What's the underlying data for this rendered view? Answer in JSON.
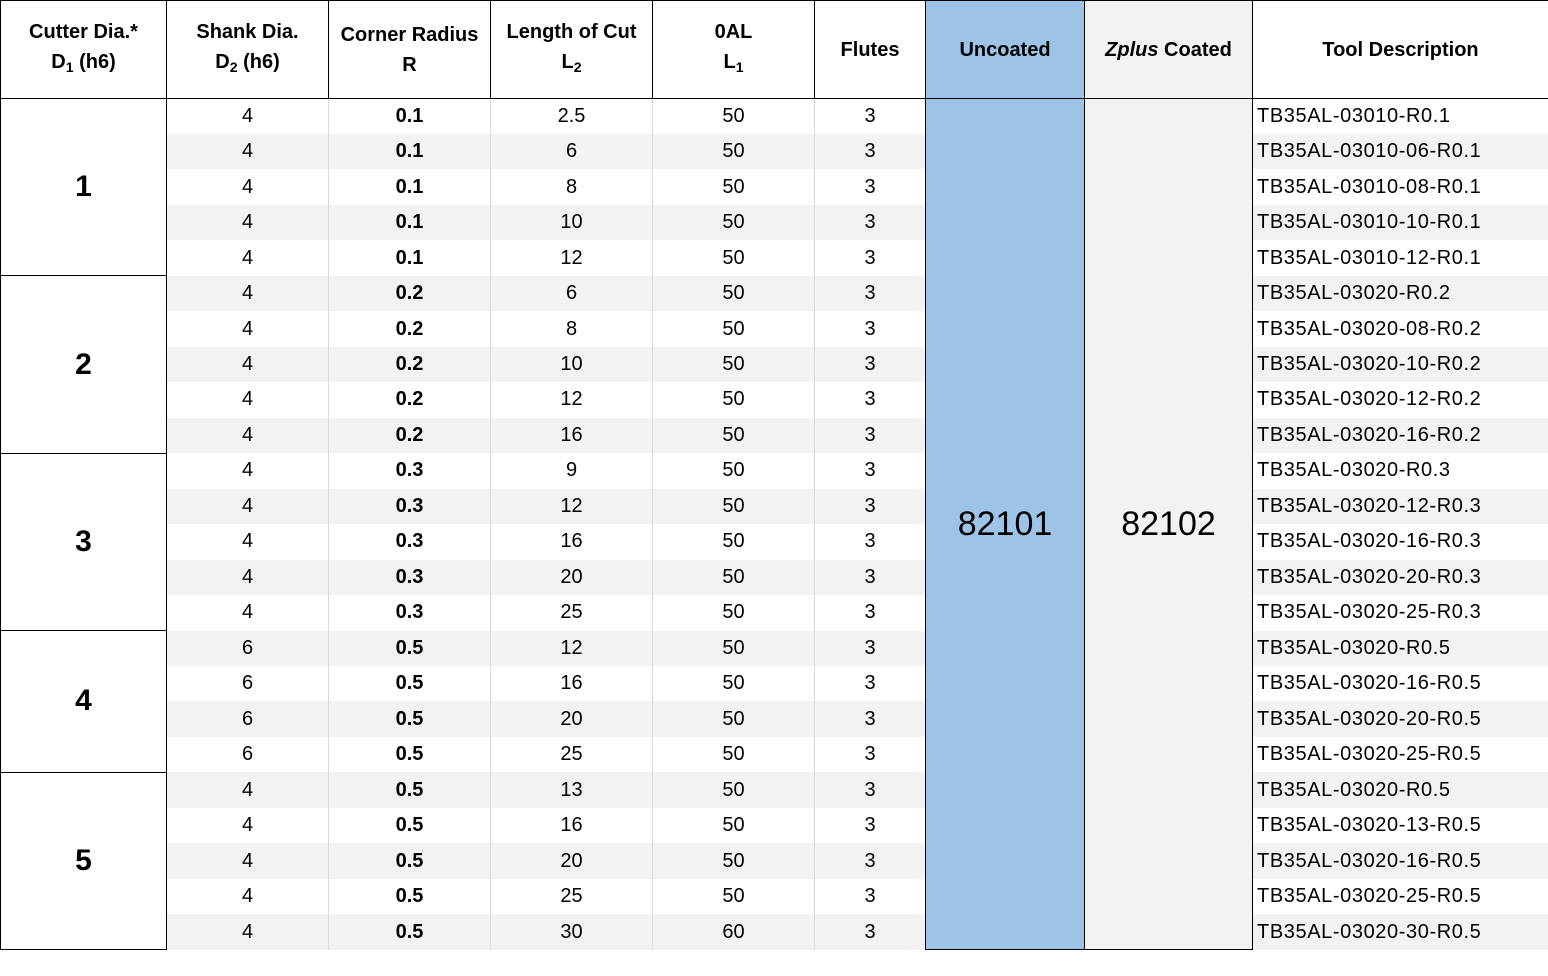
{
  "headers": {
    "cutter_dia": {
      "line1": "Cutter Dia.*",
      "main": "D",
      "sub": "1",
      "rest": " (h6)"
    },
    "shank_dia": {
      "line1": "Shank Dia.",
      "main": "D",
      "sub": "2",
      "rest": " (h6)"
    },
    "corner_radius": {
      "line1": "Corner Radius",
      "line2": "R"
    },
    "length_of_cut": {
      "line1": "Length of Cut",
      "main": "L",
      "sub": "2"
    },
    "oal": {
      "line1": "0AL",
      "main": "L",
      "sub": "1"
    },
    "flutes": "Flutes",
    "uncoated": "Uncoated",
    "zplus_italic": "Zplus",
    "zplus_rest": " Coated",
    "tool_description": "Tool Description"
  },
  "uncoated_code": "82101",
  "zplus_code": "82102",
  "groups": [
    {
      "cutter_dia": "1",
      "rows": [
        {
          "shank": "4",
          "radius": "0.1",
          "loc": "2.5",
          "oal": "50",
          "flutes": "3",
          "desc": "TB35AL-03010-R0.1"
        },
        {
          "shank": "4",
          "radius": "0.1",
          "loc": "6",
          "oal": "50",
          "flutes": "3",
          "desc": "TB35AL-03010-06-R0.1"
        },
        {
          "shank": "4",
          "radius": "0.1",
          "loc": "8",
          "oal": "50",
          "flutes": "3",
          "desc": "TB35AL-03010-08-R0.1"
        },
        {
          "shank": "4",
          "radius": "0.1",
          "loc": "10",
          "oal": "50",
          "flutes": "3",
          "desc": "TB35AL-03010-10-R0.1"
        },
        {
          "shank": "4",
          "radius": "0.1",
          "loc": "12",
          "oal": "50",
          "flutes": "3",
          "desc": "TB35AL-03010-12-R0.1"
        }
      ]
    },
    {
      "cutter_dia": "2",
      "rows": [
        {
          "shank": "4",
          "radius": "0.2",
          "loc": "6",
          "oal": "50",
          "flutes": "3",
          "desc": "TB35AL-03020-R0.2"
        },
        {
          "shank": "4",
          "radius": "0.2",
          "loc": "8",
          "oal": "50",
          "flutes": "3",
          "desc": "TB35AL-03020-08-R0.2"
        },
        {
          "shank": "4",
          "radius": "0.2",
          "loc": "10",
          "oal": "50",
          "flutes": "3",
          "desc": "TB35AL-03020-10-R0.2"
        },
        {
          "shank": "4",
          "radius": "0.2",
          "loc": "12",
          "oal": "50",
          "flutes": "3",
          "desc": "TB35AL-03020-12-R0.2"
        },
        {
          "shank": "4",
          "radius": "0.2",
          "loc": "16",
          "oal": "50",
          "flutes": "3",
          "desc": "TB35AL-03020-16-R0.2"
        }
      ]
    },
    {
      "cutter_dia": "3",
      "rows": [
        {
          "shank": "4",
          "radius": "0.3",
          "loc": "9",
          "oal": "50",
          "flutes": "3",
          "desc": "TB35AL-03020-R0.3"
        },
        {
          "shank": "4",
          "radius": "0.3",
          "loc": "12",
          "oal": "50",
          "flutes": "3",
          "desc": "TB35AL-03020-12-R0.3"
        },
        {
          "shank": "4",
          "radius": "0.3",
          "loc": "16",
          "oal": "50",
          "flutes": "3",
          "desc": "TB35AL-03020-16-R0.3"
        },
        {
          "shank": "4",
          "radius": "0.3",
          "loc": "20",
          "oal": "50",
          "flutes": "3",
          "desc": "TB35AL-03020-20-R0.3"
        },
        {
          "shank": "4",
          "radius": "0.3",
          "loc": "25",
          "oal": "50",
          "flutes": "3",
          "desc": "TB35AL-03020-25-R0.3"
        }
      ]
    },
    {
      "cutter_dia": "4",
      "rows": [
        {
          "shank": "6",
          "radius": "0.5",
          "loc": "12",
          "oal": "50",
          "flutes": "3",
          "desc": "TB35AL-03020-R0.5"
        },
        {
          "shank": "6",
          "radius": "0.5",
          "loc": "16",
          "oal": "50",
          "flutes": "3",
          "desc": "TB35AL-03020-16-R0.5"
        },
        {
          "shank": "6",
          "radius": "0.5",
          "loc": "20",
          "oal": "50",
          "flutes": "3",
          "desc": "TB35AL-03020-20-R0.5"
        },
        {
          "shank": "6",
          "radius": "0.5",
          "loc": "25",
          "oal": "50",
          "flutes": "3",
          "desc": "TB35AL-03020-25-R0.5"
        }
      ]
    },
    {
      "cutter_dia": "5",
      "rows": [
        {
          "shank": "4",
          "radius": "0.5",
          "loc": "13",
          "oal": "50",
          "flutes": "3",
          "desc": "TB35AL-03020-R0.5"
        },
        {
          "shank": "4",
          "radius": "0.5",
          "loc": "16",
          "oal": "50",
          "flutes": "3",
          "desc": "TB35AL-03020-13-R0.5"
        },
        {
          "shank": "4",
          "radius": "0.5",
          "loc": "20",
          "oal": "50",
          "flutes": "3",
          "desc": "TB35AL-03020-16-R0.5"
        },
        {
          "shank": "4",
          "radius": "0.5",
          "loc": "25",
          "oal": "50",
          "flutes": "3",
          "desc": "TB35AL-03020-25-R0.5"
        },
        {
          "shank": "4",
          "radius": "0.5",
          "loc": "30",
          "oal": "60",
          "flutes": "3",
          "desc": "TB35AL-03020-30-R0.5"
        }
      ]
    }
  ]
}
